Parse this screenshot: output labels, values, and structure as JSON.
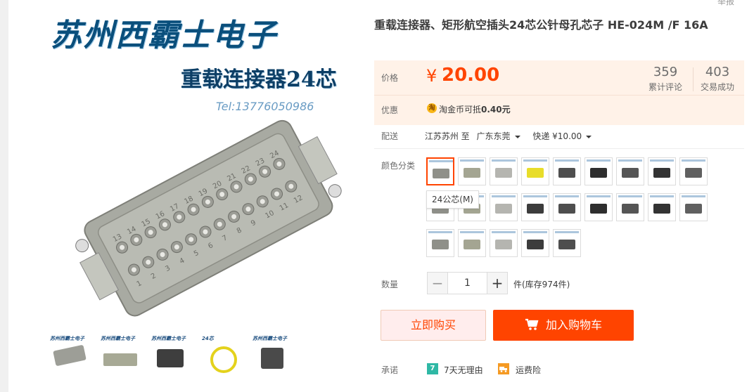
{
  "report_link": "举报",
  "gallery": {
    "brand_title": "苏州西霸士电子",
    "brand_subtitle": "重载连接器24芯",
    "brand_tel": "Tel:13776050986",
    "pin_numbers_top": [
      "24",
      "23",
      "22",
      "21",
      "20",
      "19",
      "18",
      "17",
      "16",
      "15",
      "14",
      "13"
    ],
    "pin_numbers_bottom": [
      "12",
      "11",
      "10",
      "9",
      "8",
      "7",
      "6",
      "5",
      "4",
      "3",
      "2",
      "1"
    ],
    "thumbnails": [
      {
        "name": "thumb-1",
        "caption": "苏州西霸士电子"
      },
      {
        "name": "thumb-2",
        "caption": "苏州西霸士电子"
      },
      {
        "name": "thumb-3",
        "caption": "苏州西霸士电子"
      },
      {
        "name": "thumb-4",
        "caption": "24芯"
      },
      {
        "name": "thumb-5",
        "caption": "苏州西霸士电子"
      }
    ]
  },
  "product": {
    "title": "重载连接器、矩形航空插头24芯公针母孔芯子 HE-024M /F 16A",
    "price_label": "价格",
    "currency": "¥",
    "price": "20.00",
    "reviews_count": "359",
    "reviews_label": "累计评论",
    "sales_count": "403",
    "sales_label": "交易成功",
    "promo_label": "优惠",
    "coin_icon": "淘",
    "promo_text": "淘金币可抵",
    "promo_value": "0.40元"
  },
  "shipping": {
    "label": "配送",
    "from": "江苏苏州 至",
    "to": "广东东莞",
    "method": "快递 ¥10.00"
  },
  "sku": {
    "label": "颜色分类",
    "tooltip": "24公芯(M)",
    "selected_index": 0,
    "item_count": 23
  },
  "quantity": {
    "label": "数量",
    "minus": "−",
    "value": "1",
    "plus": "+",
    "stock_text": "件(库存974件)"
  },
  "actions": {
    "buy_now": "立即购买",
    "add_to_cart": "加入购物车"
  },
  "promise": {
    "label": "承诺",
    "item1_icon": "7",
    "item1_text": "7天无理由",
    "item2_text": "运费险"
  },
  "colors": {
    "accent": "#ff4400",
    "price_bg": "#fff2e8"
  }
}
